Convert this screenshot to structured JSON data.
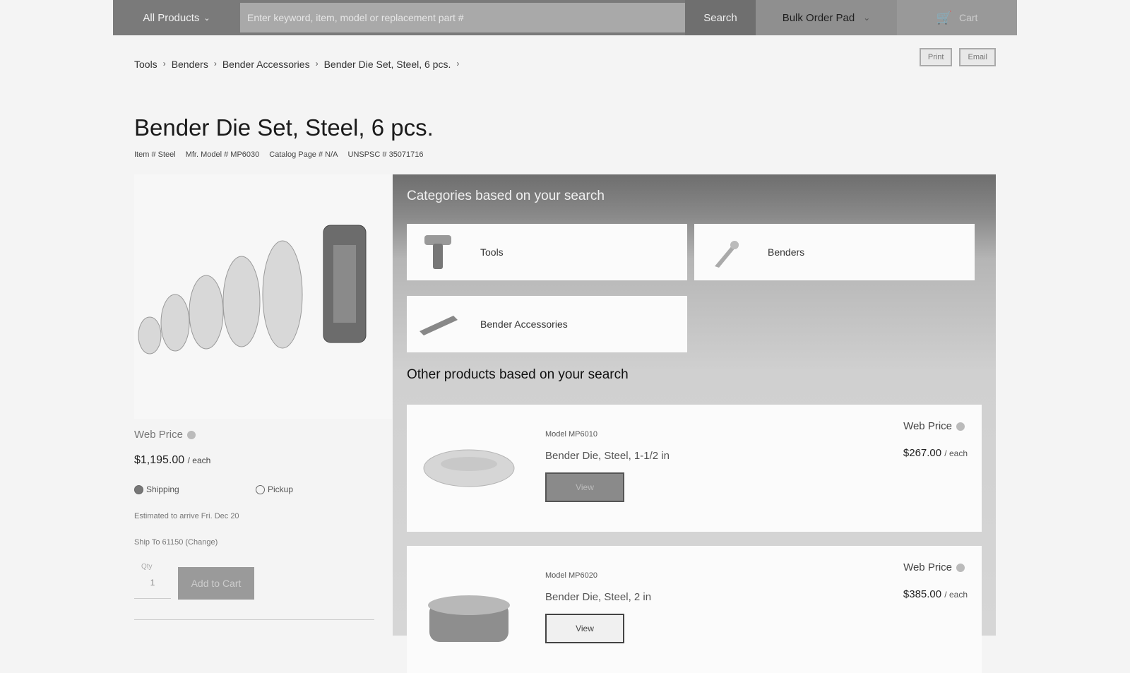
{
  "header": {
    "department": "All Products",
    "search_placeholder": "Enter keyword, item, model or replacement part #",
    "search_button": "Search",
    "bulk_order": "Bulk Order Pad",
    "cart_label": "Cart"
  },
  "utility_buttons": [
    "Print",
    "Email"
  ],
  "breadcrumb": [
    {
      "label": "Tools"
    },
    {
      "label": "Benders"
    },
    {
      "label": "Bender Accessories"
    },
    {
      "label": "Bender Die Set, Steel, 6 pcs."
    }
  ],
  "product": {
    "title": "Bender Die Set, Steel, 6 pcs.",
    "meta": [
      "Item # Steel",
      "Mfr. Model # MP6030",
      "Catalog Page # N/A",
      "UNSPSC # 35071716"
    ],
    "web_price_label": "Web Price",
    "price": "$1,195.00",
    "price_unit": "/ each",
    "shipping_label": "Shipping",
    "pickup_label": "Pickup",
    "delivery_note": "Estimated to arrive Fri. Dec 20",
    "ship_to": "Ship To 61150 (Change)",
    "qty_label": "Qty",
    "qty_value": "1",
    "add_to_cart": "Add to Cart"
  },
  "categories_section": {
    "title": "Categories based on your search",
    "items": [
      {
        "label": "Tools"
      },
      {
        "label": "Benders"
      },
      {
        "label": "Bender Accessories"
      }
    ]
  },
  "other_products": {
    "title": "Other products based on your search",
    "items": [
      {
        "model": "Model MP6010",
        "name": "Bender Die, Steel, 1-1/2 in",
        "web_price_label": "Web Price",
        "price": "$267.00",
        "unit": "/ each",
        "button": "View"
      },
      {
        "model": "Model MP6020",
        "name": "Bender Die, Steel, 2 in",
        "web_price_label": "Web Price",
        "price": "$385.00",
        "unit": "/ each",
        "button": "View"
      }
    ]
  }
}
